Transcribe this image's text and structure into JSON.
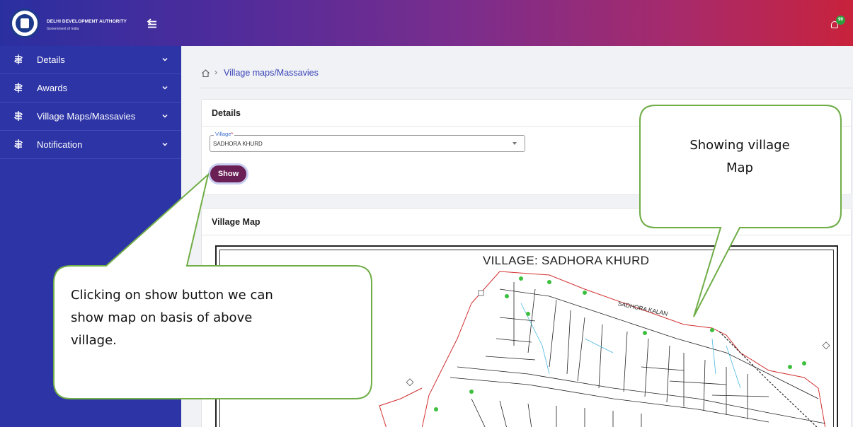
{
  "header": {
    "org_name": "DELHI DEVELOPMENT AUTHORITY",
    "org_sub": "Government of India",
    "notification_count": "99",
    "colors": {
      "start": "#2a2fa0",
      "end": "#c8223c"
    }
  },
  "sidebar": {
    "items": [
      {
        "label": "Details"
      },
      {
        "label": "Awards"
      },
      {
        "label": "Village Maps/Massavies"
      },
      {
        "label": "Notification"
      }
    ]
  },
  "breadcrumb": {
    "current": "Village maps/Massavies"
  },
  "details_card": {
    "title": "Details",
    "village_label": "Village",
    "village_required": "*",
    "village_value": "SADHORA KHURD",
    "show_button": "Show"
  },
  "map_card": {
    "title": "Village Map",
    "map_title": "VILLAGE: SADHORA KHURD",
    "map_neighbor_label": "SADHORA KALAN"
  },
  "callouts": {
    "right_line1": "Showing village",
    "right_line2": "Map",
    "left_line1": "Clicking on show button we can",
    "left_line2": "show map on basis of above",
    "left_line3": "village."
  },
  "icons": {
    "menu_collapse": "collapse-sidebar-icon",
    "side_item": "route-icon",
    "home": "home-icon",
    "bell": "bell-icon"
  }
}
